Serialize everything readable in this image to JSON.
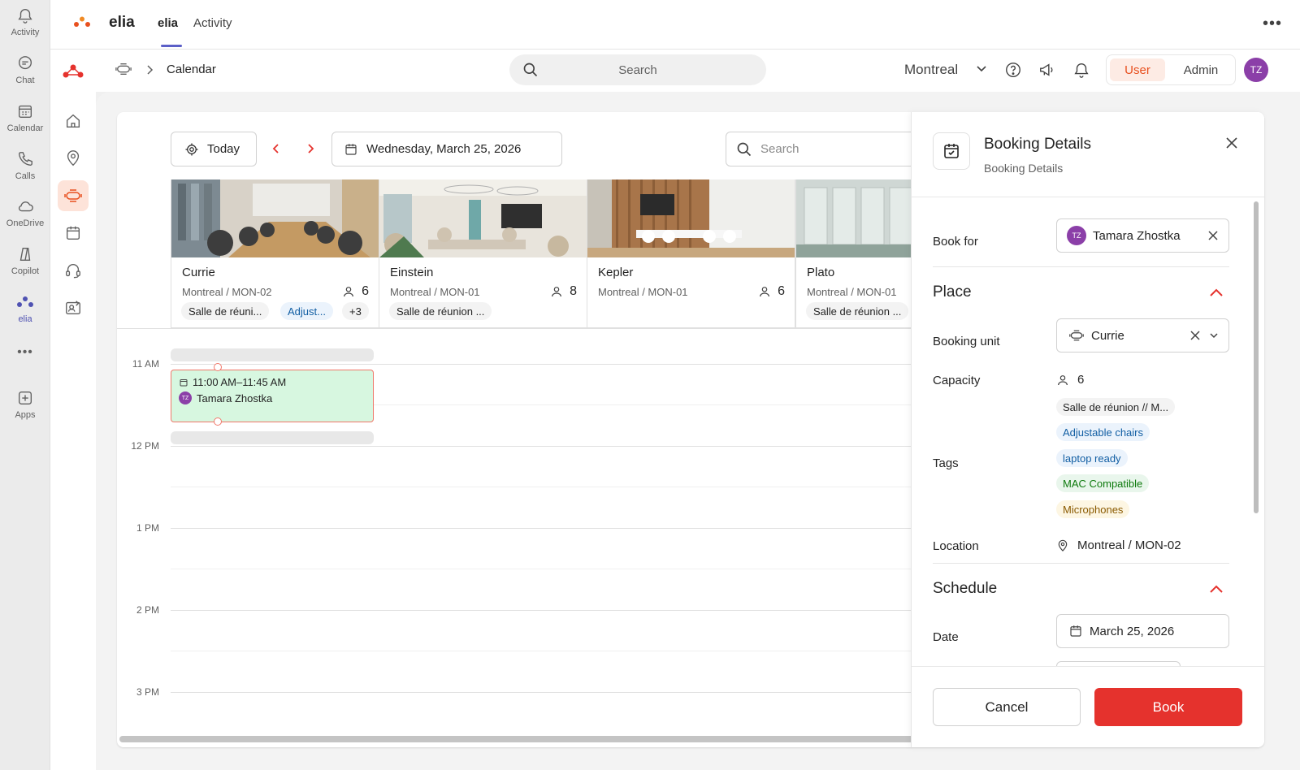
{
  "rail": {
    "items": [
      {
        "label": "Activity",
        "icon": "bell-icon"
      },
      {
        "label": "Chat",
        "icon": "chat-icon"
      },
      {
        "label": "Calendar",
        "icon": "calendar-icon"
      },
      {
        "label": "Calls",
        "icon": "phone-icon"
      },
      {
        "label": "OneDrive",
        "icon": "cloud-icon"
      },
      {
        "label": "Copilot",
        "icon": "copilot-icon"
      },
      {
        "label": "elia",
        "icon": "elia-logo-icon"
      },
      {
        "label": "Apps",
        "icon": "add-apps-icon"
      }
    ],
    "more": "•••"
  },
  "appbar": {
    "app_name": "elia",
    "tabs": [
      {
        "label": "elia"
      },
      {
        "label": "Activity"
      }
    ],
    "more": "•••"
  },
  "subbar": {
    "breadcrumb": "Calendar",
    "search_placeholder": "Search",
    "location": "Montreal",
    "toggle": {
      "user": "User",
      "admin": "Admin"
    },
    "avatar_initials": "TZ"
  },
  "toolbar": {
    "today_label": "Today",
    "date": "Wednesday, March 25, 2026",
    "search_placeholder": "Search"
  },
  "rooms": [
    {
      "name": "Currie",
      "location": "Montreal / MON-02",
      "capacity": "6",
      "chips": [
        "Salle de réuni...",
        "Adjust...",
        "+3"
      ]
    },
    {
      "name": "Einstein",
      "location": "Montreal / MON-01",
      "capacity": "8",
      "chips": [
        "Salle de réunion ..."
      ]
    },
    {
      "name": "Kepler",
      "location": "Montreal / MON-01",
      "capacity": "6",
      "chips": []
    },
    {
      "name": "Plato",
      "location": "Montreal / MON-01",
      "capacity": "",
      "chips": [
        "Salle de réunion ..."
      ]
    }
  ],
  "schedule": {
    "hours": [
      "11 AM",
      "12 PM",
      "1 PM",
      "2 PM",
      "3 PM"
    ],
    "event": {
      "time": "11:00 AM–11:45 AM",
      "person": "Tamara Zhostka",
      "initials": "TZ"
    }
  },
  "panel": {
    "title": "Booking Details",
    "subtitle": "Booking Details",
    "book_for_label": "Book for",
    "book_for_name": "Tamara Zhostka",
    "book_for_initials": "TZ",
    "place_title": "Place",
    "booking_unit_label": "Booking unit",
    "booking_unit_value": "Currie",
    "capacity_label": "Capacity",
    "capacity_value": "6",
    "tags_label": "Tags",
    "tags": [
      {
        "text": "Salle de réunion // M...",
        "color": "gray"
      },
      {
        "text": "Adjustable chairs",
        "color": "blue"
      },
      {
        "text": "laptop ready",
        "color": "blue"
      },
      {
        "text": "MAC Compatible",
        "color": "green"
      },
      {
        "text": "Microphones",
        "color": "yellow"
      }
    ],
    "location_label": "Location",
    "location_value": "Montreal / MON-02",
    "schedule_title": "Schedule",
    "date_label": "Date",
    "date_value": "March 25, 2026",
    "cancel_label": "Cancel",
    "book_label": "Book"
  },
  "colors": {
    "accent": "#e5322d",
    "brand_orange": "#e8501f",
    "teams_purple": "#5b5fc7",
    "event_bg": "#d7f7e0"
  }
}
